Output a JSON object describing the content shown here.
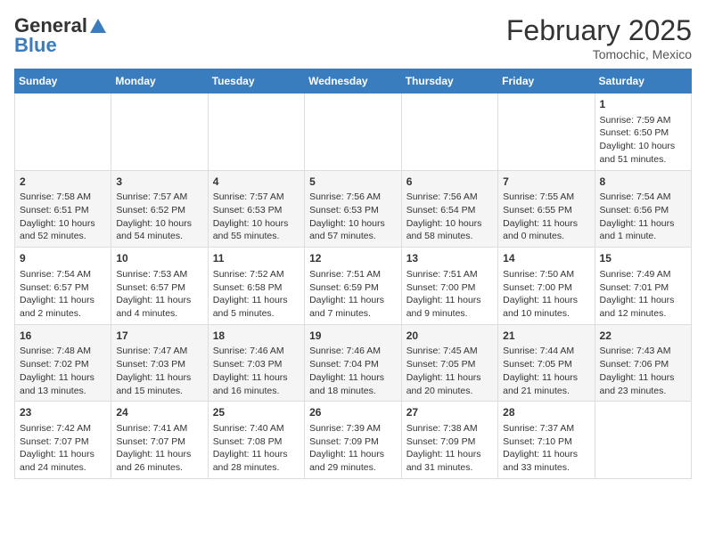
{
  "header": {
    "logo_general": "General",
    "logo_blue": "Blue",
    "month": "February 2025",
    "location": "Tomochic, Mexico"
  },
  "days_of_week": [
    "Sunday",
    "Monday",
    "Tuesday",
    "Wednesday",
    "Thursday",
    "Friday",
    "Saturday"
  ],
  "weeks": [
    [
      {
        "day": "",
        "content": ""
      },
      {
        "day": "",
        "content": ""
      },
      {
        "day": "",
        "content": ""
      },
      {
        "day": "",
        "content": ""
      },
      {
        "day": "",
        "content": ""
      },
      {
        "day": "",
        "content": ""
      },
      {
        "day": "1",
        "content": "Sunrise: 7:59 AM\nSunset: 6:50 PM\nDaylight: 10 hours\nand 51 minutes."
      }
    ],
    [
      {
        "day": "2",
        "content": "Sunrise: 7:58 AM\nSunset: 6:51 PM\nDaylight: 10 hours\nand 52 minutes."
      },
      {
        "day": "3",
        "content": "Sunrise: 7:57 AM\nSunset: 6:52 PM\nDaylight: 10 hours\nand 54 minutes."
      },
      {
        "day": "4",
        "content": "Sunrise: 7:57 AM\nSunset: 6:53 PM\nDaylight: 10 hours\nand 55 minutes."
      },
      {
        "day": "5",
        "content": "Sunrise: 7:56 AM\nSunset: 6:53 PM\nDaylight: 10 hours\nand 57 minutes."
      },
      {
        "day": "6",
        "content": "Sunrise: 7:56 AM\nSunset: 6:54 PM\nDaylight: 10 hours\nand 58 minutes."
      },
      {
        "day": "7",
        "content": "Sunrise: 7:55 AM\nSunset: 6:55 PM\nDaylight: 11 hours\nand 0 minutes."
      },
      {
        "day": "8",
        "content": "Sunrise: 7:54 AM\nSunset: 6:56 PM\nDaylight: 11 hours\nand 1 minute."
      }
    ],
    [
      {
        "day": "9",
        "content": "Sunrise: 7:54 AM\nSunset: 6:57 PM\nDaylight: 11 hours\nand 2 minutes."
      },
      {
        "day": "10",
        "content": "Sunrise: 7:53 AM\nSunset: 6:57 PM\nDaylight: 11 hours\nand 4 minutes."
      },
      {
        "day": "11",
        "content": "Sunrise: 7:52 AM\nSunset: 6:58 PM\nDaylight: 11 hours\nand 5 minutes."
      },
      {
        "day": "12",
        "content": "Sunrise: 7:51 AM\nSunset: 6:59 PM\nDaylight: 11 hours\nand 7 minutes."
      },
      {
        "day": "13",
        "content": "Sunrise: 7:51 AM\nSunset: 7:00 PM\nDaylight: 11 hours\nand 9 minutes."
      },
      {
        "day": "14",
        "content": "Sunrise: 7:50 AM\nSunset: 7:00 PM\nDaylight: 11 hours\nand 10 minutes."
      },
      {
        "day": "15",
        "content": "Sunrise: 7:49 AM\nSunset: 7:01 PM\nDaylight: 11 hours\nand 12 minutes."
      }
    ],
    [
      {
        "day": "16",
        "content": "Sunrise: 7:48 AM\nSunset: 7:02 PM\nDaylight: 11 hours\nand 13 minutes."
      },
      {
        "day": "17",
        "content": "Sunrise: 7:47 AM\nSunset: 7:03 PM\nDaylight: 11 hours\nand 15 minutes."
      },
      {
        "day": "18",
        "content": "Sunrise: 7:46 AM\nSunset: 7:03 PM\nDaylight: 11 hours\nand 16 minutes."
      },
      {
        "day": "19",
        "content": "Sunrise: 7:46 AM\nSunset: 7:04 PM\nDaylight: 11 hours\nand 18 minutes."
      },
      {
        "day": "20",
        "content": "Sunrise: 7:45 AM\nSunset: 7:05 PM\nDaylight: 11 hours\nand 20 minutes."
      },
      {
        "day": "21",
        "content": "Sunrise: 7:44 AM\nSunset: 7:05 PM\nDaylight: 11 hours\nand 21 minutes."
      },
      {
        "day": "22",
        "content": "Sunrise: 7:43 AM\nSunset: 7:06 PM\nDaylight: 11 hours\nand 23 minutes."
      }
    ],
    [
      {
        "day": "23",
        "content": "Sunrise: 7:42 AM\nSunset: 7:07 PM\nDaylight: 11 hours\nand 24 minutes."
      },
      {
        "day": "24",
        "content": "Sunrise: 7:41 AM\nSunset: 7:07 PM\nDaylight: 11 hours\nand 26 minutes."
      },
      {
        "day": "25",
        "content": "Sunrise: 7:40 AM\nSunset: 7:08 PM\nDaylight: 11 hours\nand 28 minutes."
      },
      {
        "day": "26",
        "content": "Sunrise: 7:39 AM\nSunset: 7:09 PM\nDaylight: 11 hours\nand 29 minutes."
      },
      {
        "day": "27",
        "content": "Sunrise: 7:38 AM\nSunset: 7:09 PM\nDaylight: 11 hours\nand 31 minutes."
      },
      {
        "day": "28",
        "content": "Sunrise: 7:37 AM\nSunset: 7:10 PM\nDaylight: 11 hours\nand 33 minutes."
      },
      {
        "day": "",
        "content": ""
      }
    ]
  ]
}
